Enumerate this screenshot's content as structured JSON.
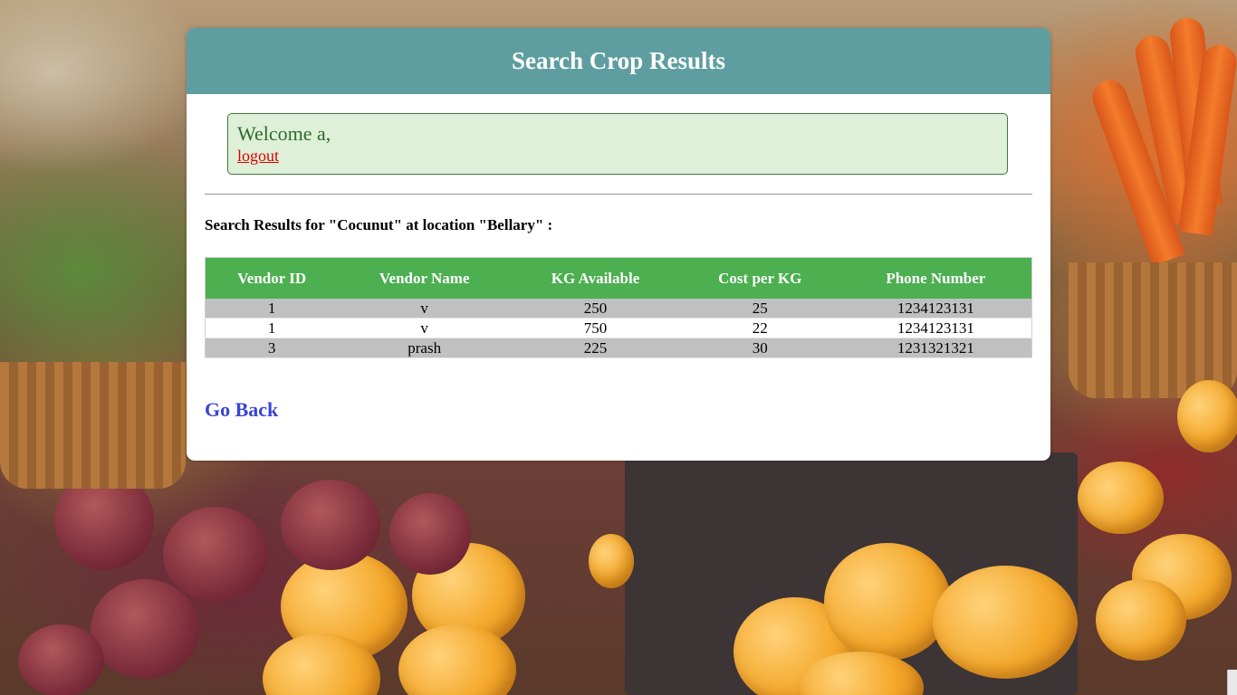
{
  "header": {
    "title": "Search Crop Results"
  },
  "welcome": {
    "text": "Welcome a,",
    "logout_label": "logout"
  },
  "results": {
    "caption": "Search Results for \"Cocunut\" at location \"Bellary\" :",
    "columns": [
      "Vendor ID",
      "Vendor Name",
      "KG Available",
      "Cost per KG",
      "Phone Number"
    ],
    "rows": [
      [
        "1",
        "v",
        "250",
        "25",
        "1234123131"
      ],
      [
        "1",
        "v",
        "750",
        "22",
        "1234123131"
      ],
      [
        "3",
        "prash",
        "225",
        "30",
        "1231321321"
      ]
    ]
  },
  "footer": {
    "go_back_label": "Go Back"
  },
  "colors": {
    "header_bg": "#5f9ea0",
    "table_header_bg": "#4caf50",
    "welcome_bg": "#dff0d8",
    "logout": "#dd0000",
    "go_back": "#3a45d6"
  }
}
